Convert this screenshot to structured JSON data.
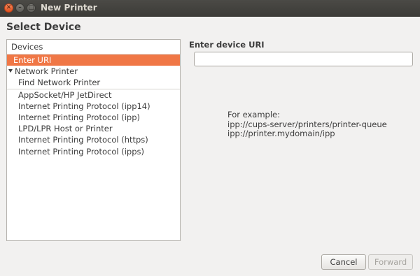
{
  "window": {
    "title": "New Printer",
    "close_glyph": "✕",
    "minimize_glyph": "–",
    "maximize_glyph": "□"
  },
  "heading": "Select Device",
  "devices": {
    "header": "Devices",
    "items": [
      {
        "label": "Enter URI",
        "selected": true
      },
      {
        "label": "Network Printer",
        "group": true
      },
      {
        "label": "Find Network Printer"
      },
      {
        "label": "AppSocket/HP JetDirect"
      },
      {
        "label": "Internet Printing Protocol (ipp14)"
      },
      {
        "label": "Internet Printing Protocol (ipp)"
      },
      {
        "label": "LPD/LPR Host or Printer"
      },
      {
        "label": "Internet Printing Protocol (https)"
      },
      {
        "label": "Internet Printing Protocol (ipps)"
      }
    ]
  },
  "uri": {
    "label": "Enter device URI",
    "value": "",
    "example_line1": "For example:",
    "example_line2": "ipp://cups-server/printers/printer-queue",
    "example_line3": "ipp://printer.mydomain/ipp"
  },
  "buttons": {
    "cancel": "Cancel",
    "forward": "Forward"
  },
  "colors": {
    "selection": "#f07746",
    "titlebar": "#3c3b37",
    "close_button": "#e95420"
  }
}
